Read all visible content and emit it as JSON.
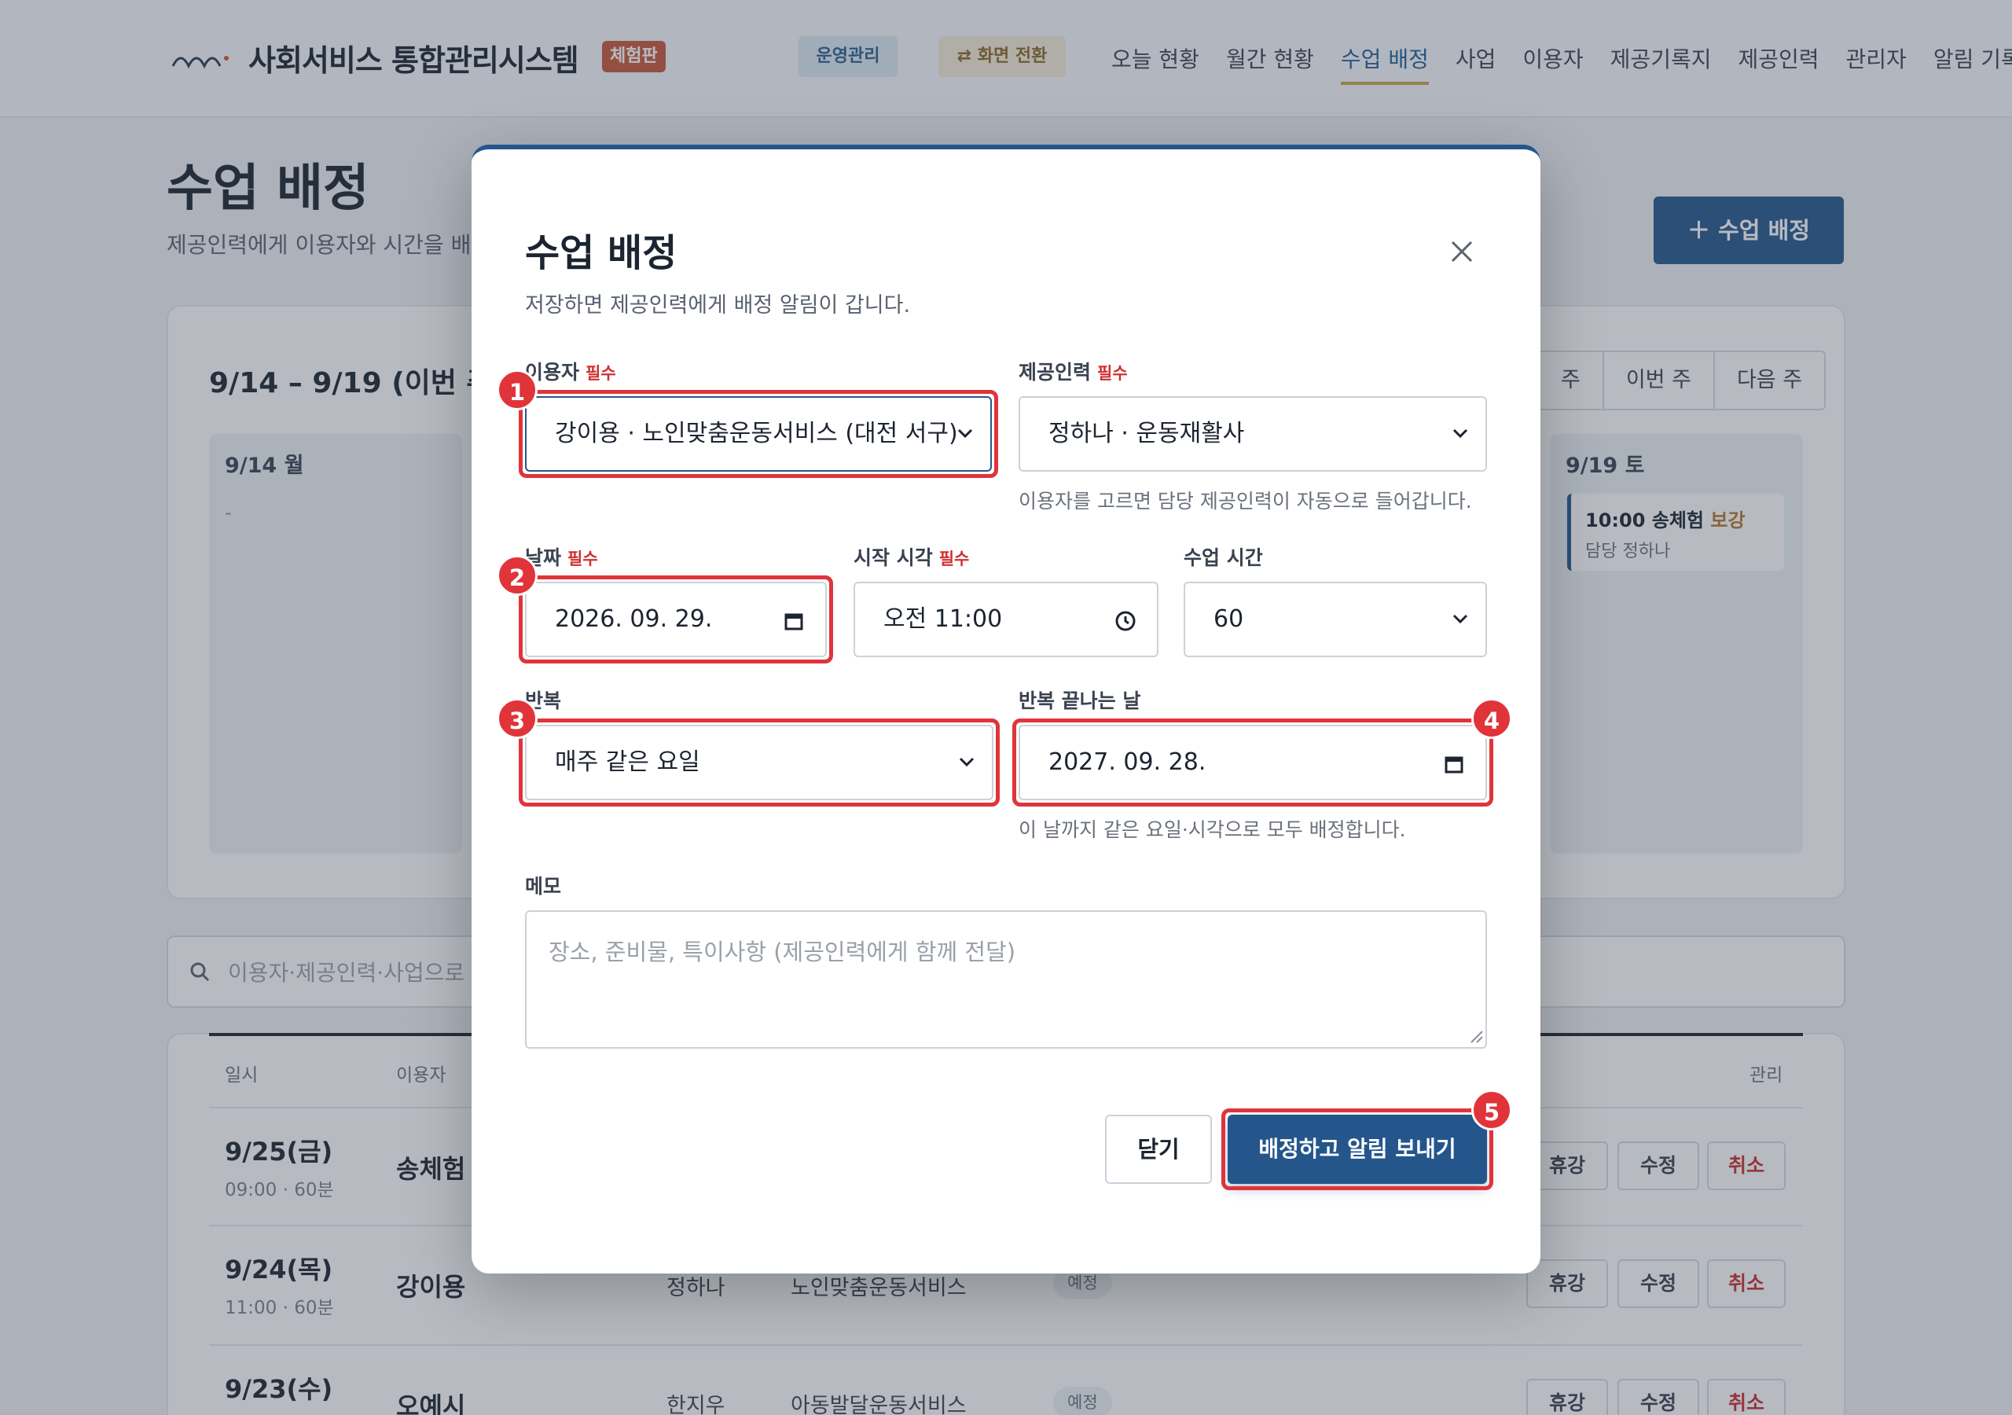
{
  "header": {
    "app_title": "사회서비스 통합관리시스템",
    "trial_badge": "체험판",
    "ops_button": "운영관리",
    "switch_button": "⇄ 화면 전환",
    "nav": [
      "오늘 현황",
      "월간 현황",
      "수업 배정",
      "사업",
      "이용자",
      "제공기록지",
      "제공인력",
      "관리자",
      "알림 기록"
    ]
  },
  "page": {
    "title": "수업 배정",
    "subtitle": "제공인력에게 이용자와 시간을 배",
    "add_button": "＋ 수업 배정"
  },
  "week": {
    "label": "9/14 – 9/19 (이번 주)",
    "tabs": [
      "주",
      "이번 주",
      "다음 주"
    ],
    "first_day": {
      "name": "9/14 월",
      "empty": "-"
    },
    "last_day": {
      "name": "9/19 토",
      "event_time": "10:00 송체험",
      "event_tag": "보강",
      "event_staff": "담당 정하나"
    }
  },
  "search": {
    "placeholder": "이용자·제공인력·사업으로"
  },
  "table": {
    "headers": {
      "date": "일시",
      "user": "이용자",
      "manage": "관리"
    },
    "rows": [
      {
        "date": "9/25(금)",
        "time": "09:00 · 60분",
        "user": "송체험",
        "staff": "",
        "business": "",
        "status": ""
      },
      {
        "date": "9/24(목)",
        "time": "11:00 · 60분",
        "user": "강이용",
        "staff": "정하나",
        "business": "노인맞춤운동서비스",
        "status": "예정"
      },
      {
        "date": "9/23(수)",
        "time": "",
        "user": "오예시",
        "staff": "한지우",
        "business": "아동발달운동서비스",
        "status": "예정"
      }
    ],
    "actions": {
      "leave": "휴강",
      "edit": "수정",
      "cancel": "취소"
    }
  },
  "modal": {
    "title": "수업 배정",
    "subtitle": "저장하면 제공인력에게 배정 알림이 갑니다.",
    "required": "필수",
    "user_label": "이용자",
    "user_value": "강이용 · 노인맞춤운동서비스 (대전 서구)",
    "staff_label": "제공인력",
    "staff_value": "정하나 · 운동재활사",
    "staff_hint": "이용자를 고르면 담당 제공인력이 자동으로 들어갑니다.",
    "date_label": "날짜",
    "date_value": "2026. 09. 29.",
    "start_label": "시작 시각",
    "start_value": "오전 11:00",
    "duration_label": "수업 시간",
    "duration_value": "60",
    "repeat_label": "반복",
    "repeat_value": "매주 같은 요일",
    "repeat_end_label": "반복 끝나는 날",
    "repeat_end_value": "2027. 09. 28.",
    "repeat_hint": "이 날까지 같은 요일·시각으로 모두 배정합니다.",
    "memo_label": "메모",
    "memo_placeholder": "장소, 준비물, 특이사항 (제공인력에게 함께 전달)",
    "close_button": "닫기",
    "submit_button": "배정하고 알림 보내기"
  },
  "callouts": [
    "1",
    "2",
    "3",
    "4",
    "5"
  ],
  "colors": {
    "primary": "#24568c",
    "highlight": "#e0343a",
    "required": "#d03030",
    "trial_badge": "#c9573a"
  }
}
